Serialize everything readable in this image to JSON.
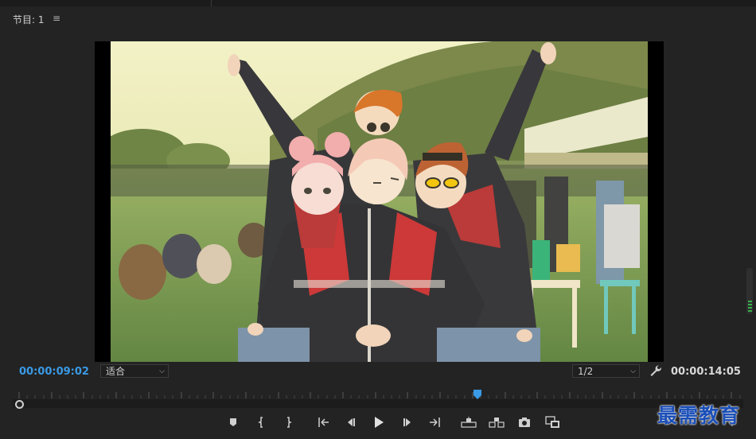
{
  "panel": {
    "title": "节目: 1",
    "menu_icon": "hamburger-menu-icon"
  },
  "timecode": {
    "current": "00:00:09:02",
    "duration": "00:00:14:05"
  },
  "fit_dropdown": {
    "value": "适合"
  },
  "resolution_dropdown": {
    "value": "1/2"
  },
  "playhead": {
    "position_fraction": 0.63
  },
  "controls": [
    {
      "name": "add-marker-button",
      "icon": "marker-icon"
    },
    {
      "name": "mark-in-button",
      "icon": "mark-in-icon"
    },
    {
      "name": "mark-out-button",
      "icon": "mark-out-icon"
    },
    {
      "name": "go-to-in-button",
      "icon": "go-to-in-icon"
    },
    {
      "name": "step-back-button",
      "icon": "step-back-icon"
    },
    {
      "name": "play-button",
      "icon": "play-icon"
    },
    {
      "name": "step-forward-button",
      "icon": "step-forward-icon"
    },
    {
      "name": "go-to-out-button",
      "icon": "go-to-out-icon"
    },
    {
      "name": "lift-button",
      "icon": "lift-icon"
    },
    {
      "name": "extract-button",
      "icon": "extract-icon"
    },
    {
      "name": "export-frame-button",
      "icon": "camera-icon"
    },
    {
      "name": "compare-view-button",
      "icon": "compare-icon"
    }
  ],
  "watermark": {
    "text": "最需教育"
  },
  "colors": {
    "accent_blue": "#3a9ae6",
    "background": "#232323"
  }
}
